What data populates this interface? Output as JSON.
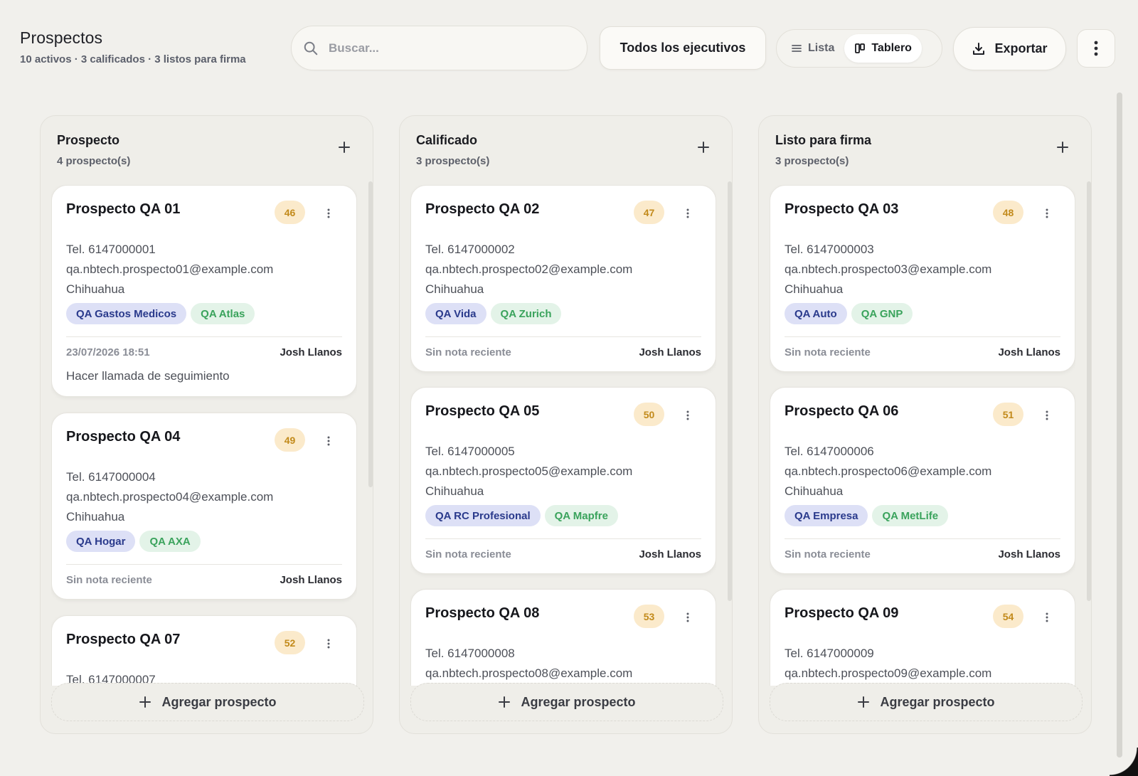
{
  "header": {
    "title": "Prospectos",
    "subtitle": "10 activos · 3 calificados · 3 listos para firma"
  },
  "search": {
    "placeholder": "Buscar..."
  },
  "executive_filter": {
    "label": "Todos los ejecutivos"
  },
  "view_toggle": {
    "list_label": "Lista",
    "board_label": "Tablero",
    "active": "Tablero"
  },
  "export_label": "Exportar",
  "add_prospect_label": "Agregar prospecto",
  "colors": {
    "score_bg": "#fbeacb",
    "score_text": "#c28a1b",
    "product_tag": "#2a3a8c",
    "insurer_tag": "#3aa35c"
  },
  "columns": [
    {
      "title": "Prospecto",
      "count": "4 prospecto(s)",
      "cards": [
        {
          "name": "Prospecto QA 01",
          "score": "46",
          "phone": "Tel. 6147000001",
          "email": "qa.nbtech.prospecto01@example.com",
          "city": "Chihuahua",
          "product": "QA Gastos Medicos",
          "insurer": "QA Atlas",
          "note_date": "23/07/2026 18:51",
          "owner": "Josh Llanos",
          "note": "Hacer llamada de seguimiento"
        },
        {
          "name": "Prospecto QA 04",
          "score": "49",
          "phone": "Tel. 6147000004",
          "email": "qa.nbtech.prospecto04@example.com",
          "city": "Chihuahua",
          "product": "QA Hogar",
          "insurer": "QA AXA",
          "note_date": "Sin nota reciente",
          "owner": "Josh Llanos"
        },
        {
          "name": "Prospecto QA 07",
          "score": "52",
          "phone": "Tel. 6147000007"
        }
      ]
    },
    {
      "title": "Calificado",
      "count": "3 prospecto(s)",
      "cards": [
        {
          "name": "Prospecto QA 02",
          "score": "47",
          "phone": "Tel. 6147000002",
          "email": "qa.nbtech.prospecto02@example.com",
          "city": "Chihuahua",
          "product": "QA Vida",
          "insurer": "QA Zurich",
          "note_date": "Sin nota reciente",
          "owner": "Josh Llanos"
        },
        {
          "name": "Prospecto QA 05",
          "score": "50",
          "phone": "Tel. 6147000005",
          "email": "qa.nbtech.prospecto05@example.com",
          "city": "Chihuahua",
          "product": "QA RC Profesional",
          "insurer": "QA Mapfre",
          "note_date": "Sin nota reciente",
          "owner": "Josh Llanos"
        },
        {
          "name": "Prospecto QA 08",
          "score": "53",
          "phone": "Tel. 6147000008",
          "email": "qa.nbtech.prospecto08@example.com"
        }
      ]
    },
    {
      "title": "Listo para firma",
      "count": "3 prospecto(s)",
      "cards": [
        {
          "name": "Prospecto QA 03",
          "score": "48",
          "phone": "Tel. 6147000003",
          "email": "qa.nbtech.prospecto03@example.com",
          "city": "Chihuahua",
          "product": "QA Auto",
          "insurer": "QA GNP",
          "note_date": "Sin nota reciente",
          "owner": "Josh Llanos"
        },
        {
          "name": "Prospecto QA 06",
          "score": "51",
          "phone": "Tel. 6147000006",
          "email": "qa.nbtech.prospecto06@example.com",
          "city": "Chihuahua",
          "product": "QA Empresa",
          "insurer": "QA MetLife",
          "note_date": "Sin nota reciente",
          "owner": "Josh Llanos"
        },
        {
          "name": "Prospecto QA 09",
          "score": "54",
          "phone": "Tel. 6147000009",
          "email": "qa.nbtech.prospecto09@example.com"
        }
      ]
    }
  ]
}
